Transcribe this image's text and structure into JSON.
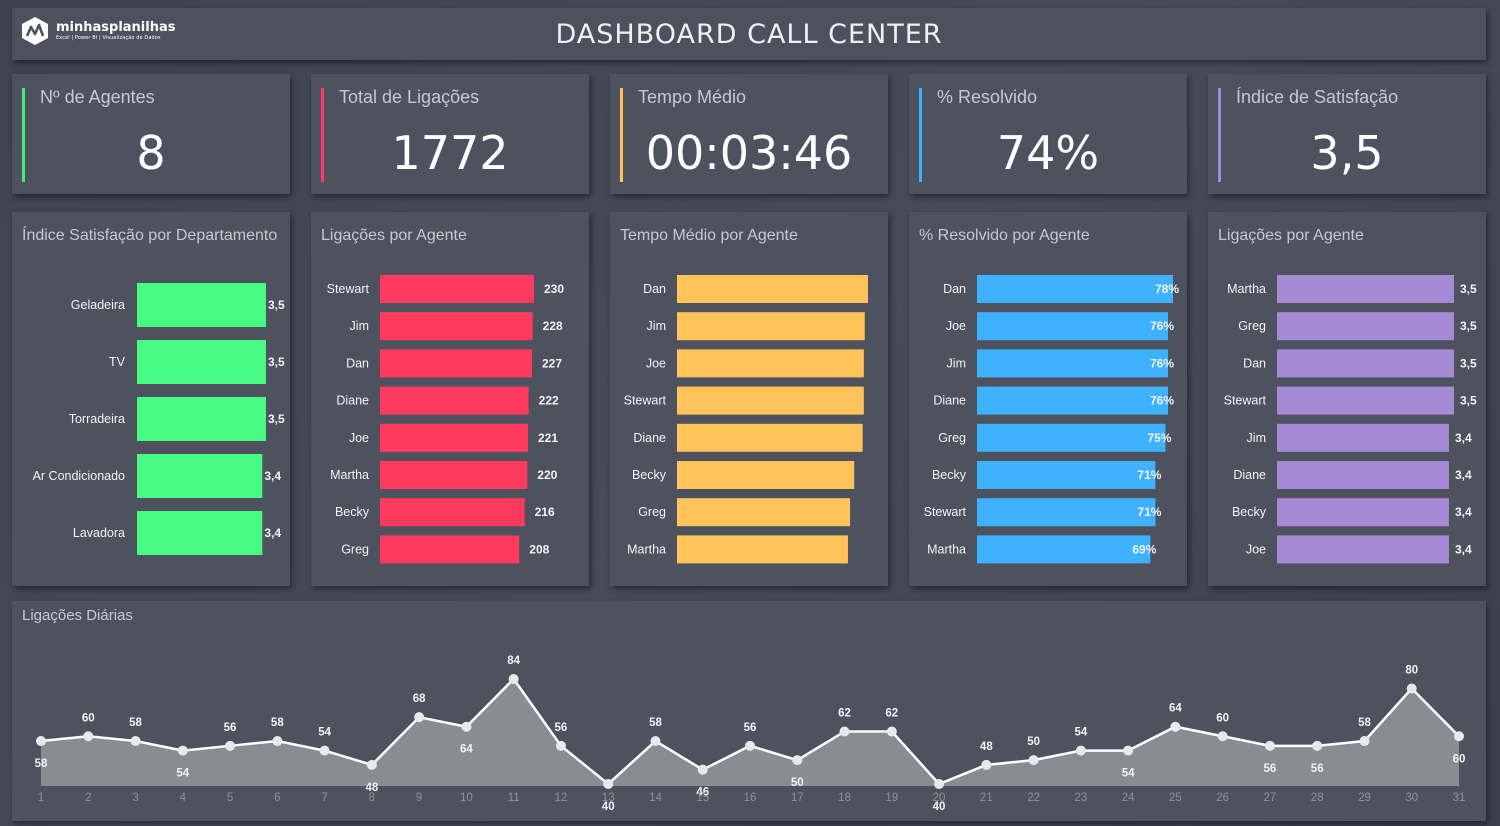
{
  "header": {
    "logo_name": "minhasplanilhas",
    "logo_tagline": "Excel | Power BI | Visualização de Dados",
    "title": "DASHBOARD CALL CENTER"
  },
  "kpis": [
    {
      "label": "Nº de Agentes",
      "value": "8",
      "color": "#3ef07e"
    },
    {
      "label": "Total de Ligações",
      "value": "1772",
      "color": "#ff3a5e"
    },
    {
      "label": "Tempo Médio",
      "value": "00:03:46",
      "color": "#ffc35a"
    },
    {
      "label": "% Resolvido",
      "value": "74%",
      "color": "#3fb2ff"
    },
    {
      "label": "Índice de Satisfação",
      "value": "3,5",
      "color": "#a58bd6"
    }
  ],
  "chart_data": [
    {
      "type": "bar",
      "title": "Índice Satisfação por Departamento",
      "orientation": "horizontal",
      "color": "#46fa82",
      "categories": [
        "Geladeira",
        "TV",
        "Torradeira",
        "Ar Condicionado",
        "Lavadora"
      ],
      "values": [
        3.5,
        3.5,
        3.5,
        3.4,
        3.4
      ],
      "labels": [
        "3,5",
        "3,5",
        "3,5",
        "3,4",
        "3,4"
      ],
      "xlim": [
        0,
        3.5
      ]
    },
    {
      "type": "bar",
      "title": "Ligações por Agente",
      "orientation": "horizontal",
      "color": "#ff3a5e",
      "categories": [
        "Stewart",
        "Jim",
        "Dan",
        "Diane",
        "Joe",
        "Martha",
        "Becky",
        "Greg"
      ],
      "values": [
        230,
        228,
        227,
        222,
        221,
        220,
        216,
        208
      ],
      "labels": [
        "230",
        "228",
        "227",
        "222",
        "221",
        "220",
        "216",
        "208"
      ],
      "xlim": [
        0,
        230
      ]
    },
    {
      "type": "bar",
      "title": "Tempo Médio por Agente",
      "orientation": "horizontal",
      "color": "#ffc35a",
      "categories": [
        "Dan",
        "Jim",
        "Joe",
        "Stewart",
        "Diane",
        "Becky",
        "Greg",
        "Martha"
      ],
      "values": [
        1.0,
        0.983,
        0.978,
        0.978,
        0.972,
        0.928,
        0.906,
        0.895
      ],
      "labels": [
        "",
        "",
        "",
        "",
        "",
        "",
        "",
        ""
      ],
      "xlim": [
        0,
        1.0
      ]
    },
    {
      "type": "bar",
      "title": "% Resolvido por Agente",
      "orientation": "horizontal",
      "color": "#3fb2ff",
      "categories": [
        "Dan",
        "Joe",
        "Jim",
        "Diane",
        "Greg",
        "Becky",
        "Stewart",
        "Martha"
      ],
      "values": [
        78,
        76,
        76,
        76,
        75,
        71,
        71,
        69
      ],
      "labels": [
        "78%",
        "76%",
        "76%",
        "76%",
        "75%",
        "71%",
        "71%",
        "69%"
      ],
      "xlim": [
        0,
        78
      ]
    },
    {
      "type": "bar",
      "title": "Ligações por Agente",
      "orientation": "horizontal",
      "color": "#a58bd6",
      "categories": [
        "Martha",
        "Greg",
        "Dan",
        "Stewart",
        "Jim",
        "Diane",
        "Becky",
        "Joe"
      ],
      "values": [
        3.5,
        3.5,
        3.5,
        3.5,
        3.4,
        3.4,
        3.4,
        3.4
      ],
      "labels": [
        "3,5",
        "3,5",
        "3,5",
        "3,5",
        "3,4",
        "3,4",
        "3,4",
        "3,4"
      ],
      "xlim": [
        0,
        3.5
      ]
    },
    {
      "type": "area",
      "title": "Ligações Diárias",
      "x": [
        1,
        2,
        3,
        4,
        5,
        6,
        7,
        8,
        9,
        10,
        11,
        12,
        13,
        14,
        15,
        16,
        17,
        18,
        19,
        20,
        21,
        22,
        23,
        24,
        25,
        26,
        27,
        28,
        29,
        30,
        31
      ],
      "values": [
        58,
        60,
        58,
        54,
        56,
        58,
        54,
        48,
        68,
        64,
        84,
        56,
        40,
        58,
        46,
        56,
        50,
        62,
        62,
        40,
        48,
        50,
        54,
        54,
        64,
        60,
        56,
        56,
        58,
        80,
        60
      ],
      "ylim": [
        40,
        84
      ]
    }
  ]
}
